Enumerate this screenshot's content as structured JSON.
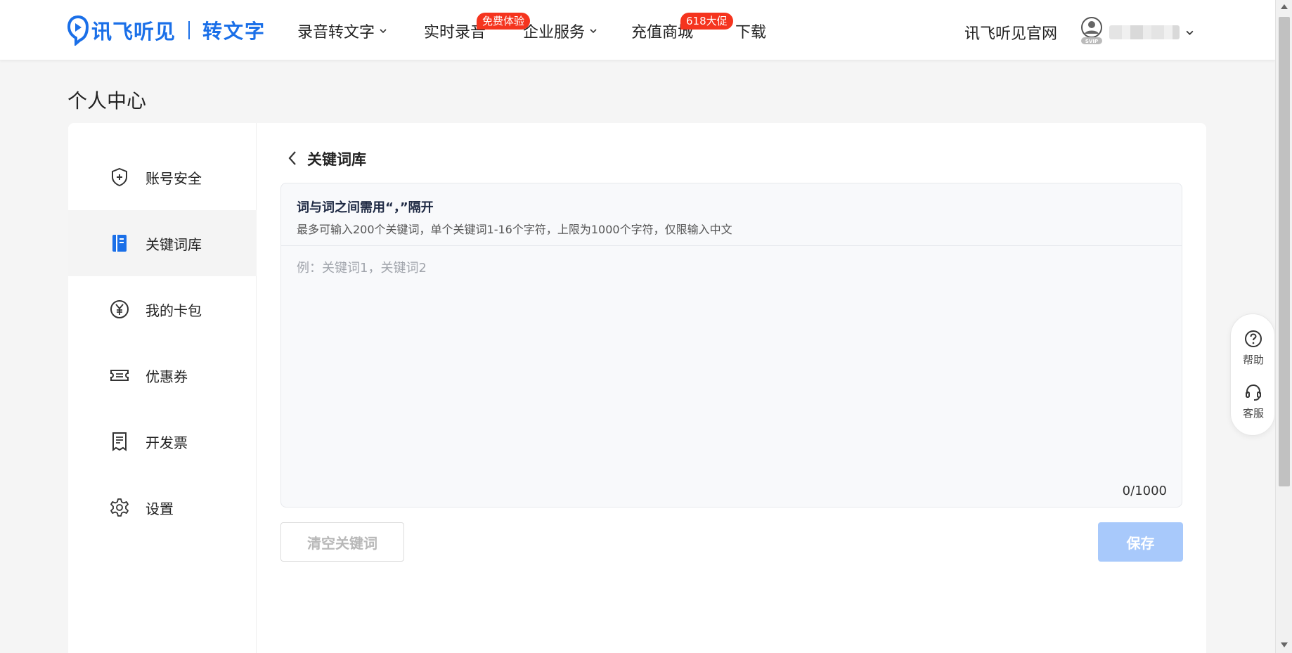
{
  "header": {
    "logo_text": "讯飞听见",
    "logo_sub": "转文字",
    "nav": [
      {
        "label": "录音转文字",
        "has_dropdown": true
      },
      {
        "label": "实时录音",
        "badge": "免费体验"
      },
      {
        "label": "企业服务",
        "has_dropdown": true
      },
      {
        "label": "充值商城",
        "badge": "618大促"
      },
      {
        "label": "下载"
      }
    ],
    "official_site": "讯飞听见官网",
    "avatar_badge": "SVIP"
  },
  "page_title": "个人中心",
  "sidebar": {
    "items": [
      {
        "label": "账号安全",
        "icon": "shield-icon"
      },
      {
        "label": "关键词库",
        "icon": "book-icon",
        "active": true
      },
      {
        "label": "我的卡包",
        "icon": "yen-icon"
      },
      {
        "label": "优惠券",
        "icon": "ticket-icon"
      },
      {
        "label": "开发票",
        "icon": "invoice-icon"
      },
      {
        "label": "设置",
        "icon": "gear-icon"
      }
    ]
  },
  "content": {
    "section_title": "关键词库",
    "tip_title": "词与词之间需用“，”隔开",
    "tip_sub": "最多可输入200个关键词，单个关键词1-16个字符，上限为1000个字符，仅限输入中文",
    "placeholder": "例：关键词1，关键词2",
    "value": "",
    "counter": "0/1000",
    "clear_label": "清空关键词",
    "save_label": "保存"
  },
  "float": {
    "help_label": "帮助",
    "service_label": "客服"
  },
  "colors": {
    "brand": "#1a6fe8",
    "badge_red": "#f5341e",
    "save_disabled": "#a8c9fb"
  }
}
